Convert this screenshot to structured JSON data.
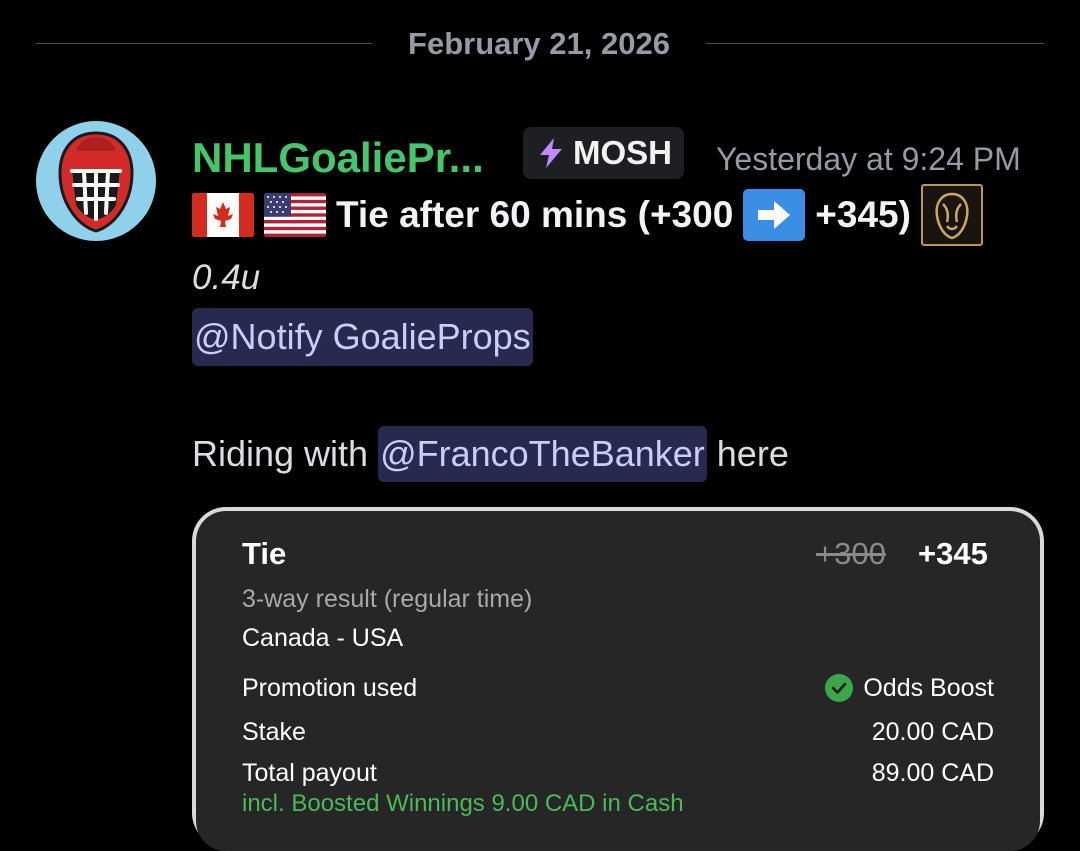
{
  "divider": {
    "date": "February 21, 2026"
  },
  "message": {
    "username": "NHLGoaliePr...",
    "tag": {
      "icon": "lightning-icon",
      "label": "MOSH"
    },
    "timestamp": "Yesterday at 9:24 PM",
    "title": {
      "flags": [
        "canada-flag-icon",
        "usa-flag-icon"
      ],
      "text_before": "Tie after 60 mins (+300",
      "arrow_icon": "right-arrow-icon",
      "text_after": "+345)",
      "book_logo": "sportsbook-lion-logo"
    },
    "units": "0.4u",
    "role_mention": "@Notify GoalieProps",
    "body": {
      "prefix": "Riding with",
      "user_mention": "@FrancoTheBanker",
      "suffix": "here"
    }
  },
  "bet_card": {
    "selection": "Tie",
    "old_odds": "+300",
    "new_odds": "+345",
    "market": "3-way result (regular time)",
    "event": "Canada - USA",
    "promotion_label": "Promotion used",
    "promotion_value": "Odds Boost",
    "stake_label": "Stake",
    "stake_value": "20.00 CAD",
    "payout_label": "Total payout",
    "payout_value": "89.00 CAD",
    "boost_note": "incl. Boosted Winnings 9.00 CAD in Cash"
  },
  "colors": {
    "background": "#000000",
    "username": "#44c76a",
    "mention_bg": "#272a4e",
    "mention_text": "#c9cdfb",
    "card_bg": "#262626",
    "boost_green": "#4cb85a"
  }
}
